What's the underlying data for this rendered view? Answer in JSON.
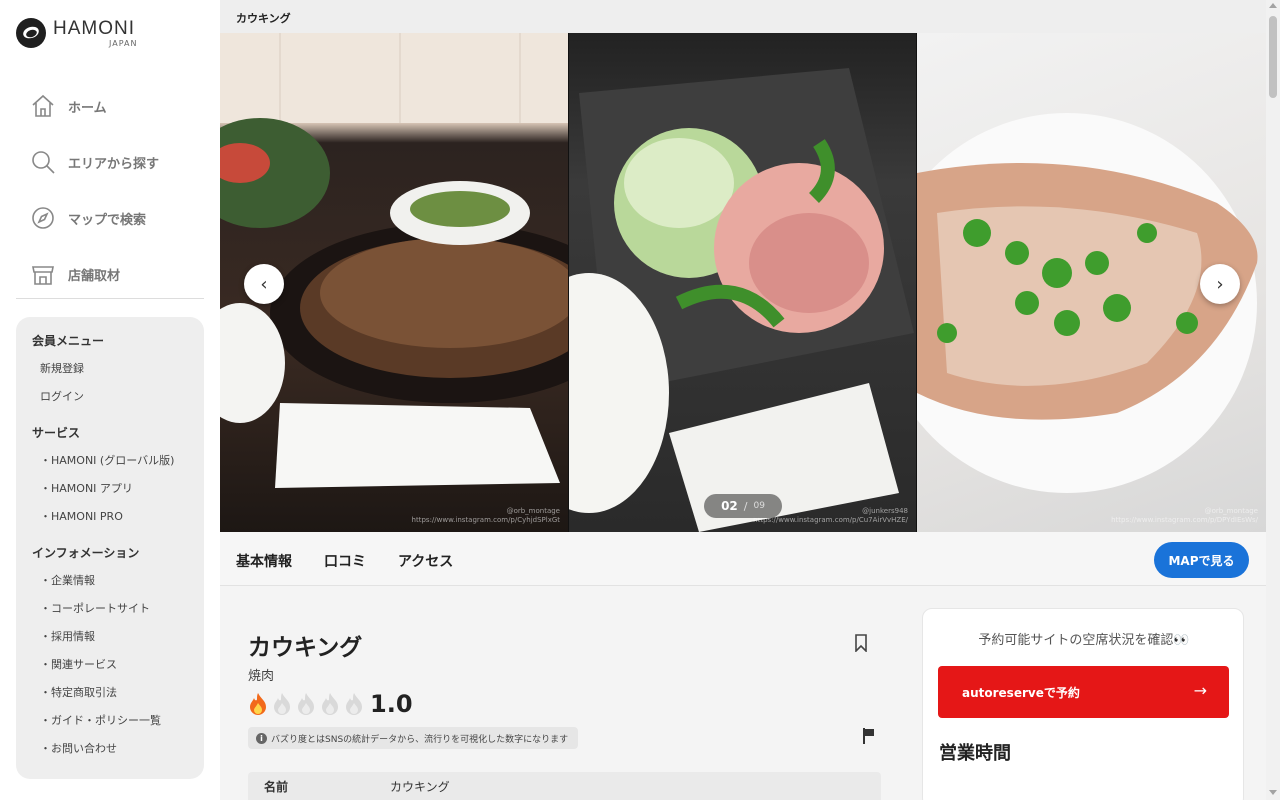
{
  "brand": {
    "name": "HAMONI",
    "sub": "JAPAN"
  },
  "nav": [
    {
      "label": "ホーム",
      "icon": "home-icon"
    },
    {
      "label": "エリアから探す",
      "icon": "search-icon"
    },
    {
      "label": "マップで検索",
      "icon": "compass-icon"
    },
    {
      "label": "店舗取材",
      "icon": "store-icon"
    }
  ],
  "menu": {
    "member": {
      "heading": "会員メニュー",
      "items": [
        "新規登録",
        "ログイン"
      ]
    },
    "service": {
      "heading": "サービス",
      "items": [
        "・HAMONI (グローバル版)",
        "・HAMONI アプリ",
        "・HAMONI PRO"
      ]
    },
    "info": {
      "heading": "インフォメーション",
      "items": [
        "・企業情報",
        "・コーポレートサイト",
        "・採用情報",
        "・関連サービス",
        "・特定商取引法",
        "・ガイド・ポリシー一覧",
        "・お問い合わせ"
      ]
    }
  },
  "topbar": {
    "title": "カウキング"
  },
  "gallery": {
    "current": "02",
    "separator": "/",
    "total": "09",
    "credits": [
      "@orb_montage\nhttps://www.instagram.com/p/CyhjdSPlxGt",
      "@junkers948\nhttps://www.instagram.com/p/Cu7AirVvHZE/",
      "@orb_montage\nhttps://www.instagram.com/p/DPYdIEsWs/"
    ]
  },
  "tabs": [
    "基本情報",
    "口コミ",
    "アクセス"
  ],
  "map_button": "MAPで見る",
  "shop": {
    "name": "カウキング",
    "category": "焼肉",
    "score": "1.0",
    "rating_level": 1,
    "rating_max": 5,
    "note": "バズり度とはSNSの統計データから、流行りを可視化した数字になります",
    "info_mark": "i",
    "detail_key": "名前",
    "detail_val": "カウキング"
  },
  "reservation": {
    "title": "予約可能サイトの空席状況を確認👀",
    "button": "autoreserveで予約",
    "arrow": "→",
    "hours_title": "営業時間"
  },
  "colors": {
    "accent_blue": "#1a73d9",
    "reserve_red": "#e51717",
    "flame_active": "#f26a1b"
  },
  "arrows": {
    "prev": "‹",
    "next": "›"
  }
}
